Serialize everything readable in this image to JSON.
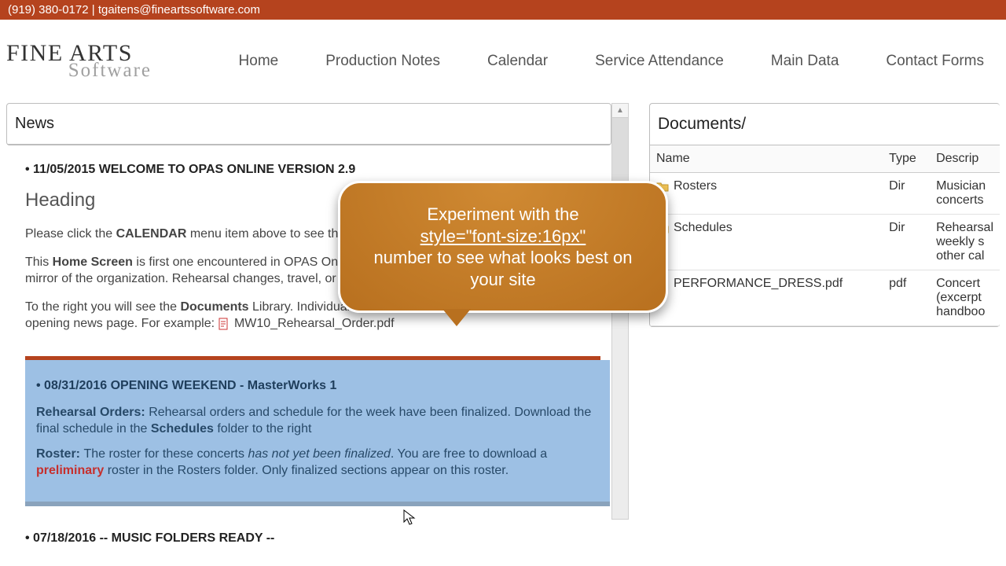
{
  "top_bar": {
    "phone": "(919) 380-0172",
    "separator": " | ",
    "email": "tgaitens@fineartssoftware.com"
  },
  "logo": {
    "line1": "FINE ARTS",
    "line2": "Software"
  },
  "nav": {
    "home": "Home",
    "production_notes": "Production Notes",
    "calendar": "Calendar",
    "service_attendance": "Service Attendance",
    "main_data": "Main Data",
    "contact_forms": "Contact Forms"
  },
  "news": {
    "header": "News",
    "item1": {
      "title": "• 11/05/2015 WELCOME TO OPAS ONLINE VERSION 2.9",
      "heading": "Heading",
      "p1_a": "Please click the ",
      "p1_b": "CALENDAR",
      "p1_c": " menu item above to see the",
      "p2_a": "This ",
      "p2_b": "Home Screen",
      "p2_c": " is first one encountered in OPAS Online mirror of the home screen to an intranet mirror of the organization. Rehearsal changes, travel, or any other important issues. A few examples",
      "p3_a": "To the right you will see the ",
      "p3_b": "Documents",
      "p3_c": " Library. Individual documents can also be linked to this opening news page. For example: ",
      "p3_link": "MW10_Rehearsal_Order.pdf"
    },
    "item2": {
      "title": "• 08/31/2016 OPENING WEEKEND - MasterWorks 1",
      "p1_a": "Rehearsal Orders: ",
      "p1_b": "Rehearsal orders and schedule for the week have been finalized. Download the final schedule in the ",
      "p1_c": "Schedules",
      "p1_d": " folder to the right",
      "p2_a": "Roster: ",
      "p2_b": "The roster for these concerts ",
      "p2_c": "has not yet been finalized",
      "p2_d": ". You are free to download a ",
      "p2_e": "preliminary",
      "p2_f": " roster in the Rosters folder. Only finalized sections appear on this roster."
    },
    "item3": {
      "title": "• 07/18/2016 -- MUSIC FOLDERS READY --"
    }
  },
  "documents": {
    "header": "Documents/",
    "columns": {
      "name": "Name",
      "type": "Type",
      "desc": "Descrip"
    },
    "rows": [
      {
        "icon": "folder",
        "name": "Rosters",
        "type": "Dir",
        "desc": "Musician concerts"
      },
      {
        "icon": "folder",
        "name": "Schedules",
        "type": "Dir",
        "desc": "Rehearsal weekly s other cal"
      },
      {
        "icon": "pdf",
        "name": "PERFORMANCE_DRESS.pdf",
        "type": "pdf",
        "desc": "Concert (excerpt handboo"
      }
    ]
  },
  "tooltip": {
    "l1": "Experiment with the",
    "l2": "style=\"font-size:16px\"",
    "l3": "number to see what looks best on your site"
  }
}
